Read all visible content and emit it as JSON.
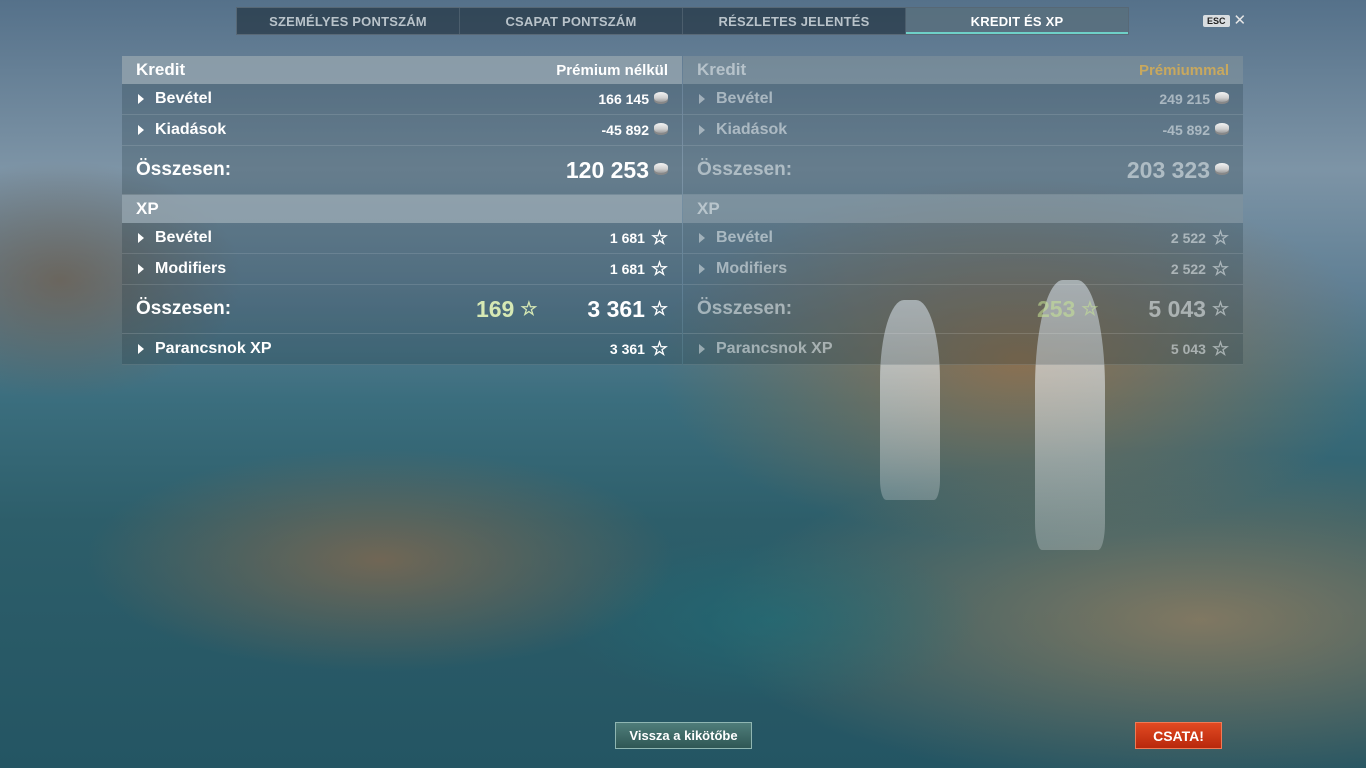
{
  "tabs": [
    {
      "label": "SZEMÉLYES PONTSZÁM"
    },
    {
      "label": "CSAPAT PONTSZÁM"
    },
    {
      "label": "RÉSZLETES JELENTÉS"
    },
    {
      "label": "KREDIT ÉS XP",
      "active": true
    }
  ],
  "esc_label": "ESC",
  "left": {
    "credit_header": "Kredit",
    "credit_sub": "Prémium nélkül",
    "credit_rows": [
      {
        "label": "Bevétel",
        "value": "166 145"
      },
      {
        "label": "Kiadások",
        "value": "-45 892"
      }
    ],
    "credit_total_label": "Összesen:",
    "credit_total": "120 253",
    "xp_header": "XP",
    "xp_rows": [
      {
        "label": "Bevétel",
        "value": "1 681"
      },
      {
        "label": "Modifiers",
        "value": "1 681"
      }
    ],
    "xp_total_label": "Összesen:",
    "xp_bonus": "169",
    "xp_total": "3 361",
    "commander_label": "Parancsnok XP",
    "commander_value": "3 361"
  },
  "right": {
    "credit_header": "Kredit",
    "credit_sub": "Prémiummal",
    "credit_rows": [
      {
        "label": "Bevétel",
        "value": "249 215"
      },
      {
        "label": "Kiadások",
        "value": "-45 892"
      }
    ],
    "credit_total_label": "Összesen:",
    "credit_total": "203 323",
    "xp_header": "XP",
    "xp_rows": [
      {
        "label": "Bevétel",
        "value": "2 522"
      },
      {
        "label": "Modifiers",
        "value": "2 522"
      }
    ],
    "xp_total_label": "Összesen:",
    "xp_bonus": "253",
    "xp_total": "5 043",
    "commander_label": "Parancsnok XP",
    "commander_value": "5 043"
  },
  "buttons": {
    "back_to_port": "Vissza a kikötőbe",
    "battle": "CSATA!"
  },
  "icons": {
    "credit": "credit-coin-icon",
    "xp": "xp-star-icon"
  },
  "colors": {
    "active_tab_accent": "#6ed0c8",
    "premium_label": "#c8a85e",
    "battle_button": "#d23a18",
    "bonus_xp": "#d6e8b4"
  }
}
